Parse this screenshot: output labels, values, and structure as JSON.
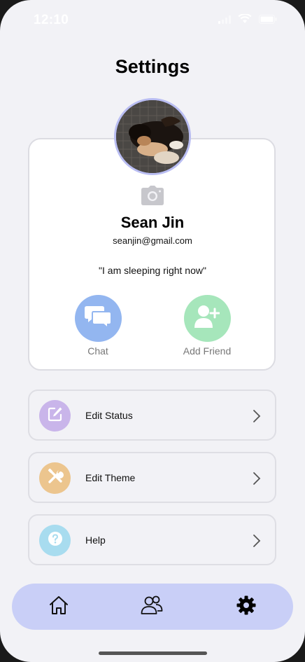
{
  "status_bar": {
    "time": "12:10"
  },
  "header": {
    "title": "Settings"
  },
  "profile": {
    "name": "Sean Jin",
    "email": "seanjin@gmail.com",
    "status": "\"I am sleeping right now\"",
    "avatar_icon": "dog-photo",
    "camera_icon": "camera-icon"
  },
  "actions": [
    {
      "label": "Chat",
      "icon": "chat-bubbles-icon",
      "color": "#93b6f0"
    },
    {
      "label": "Add Friend",
      "icon": "add-person-icon",
      "color": "#a6e6bb"
    }
  ],
  "menu": [
    {
      "label": "Edit Status",
      "icon": "pencil-icon",
      "color": "#c9b5ea"
    },
    {
      "label": "Edit Theme",
      "icon": "tools-icon",
      "color": "#ecc58e"
    },
    {
      "label": "Help",
      "icon": "question-icon",
      "color": "#a8dcef"
    }
  ],
  "tab_bar": {
    "background": "#c9cff7",
    "items": [
      {
        "name": "home",
        "icon": "home-icon",
        "active": false
      },
      {
        "name": "friends",
        "icon": "people-icon",
        "active": false
      },
      {
        "name": "settings",
        "icon": "gear-icon",
        "active": true
      }
    ]
  }
}
